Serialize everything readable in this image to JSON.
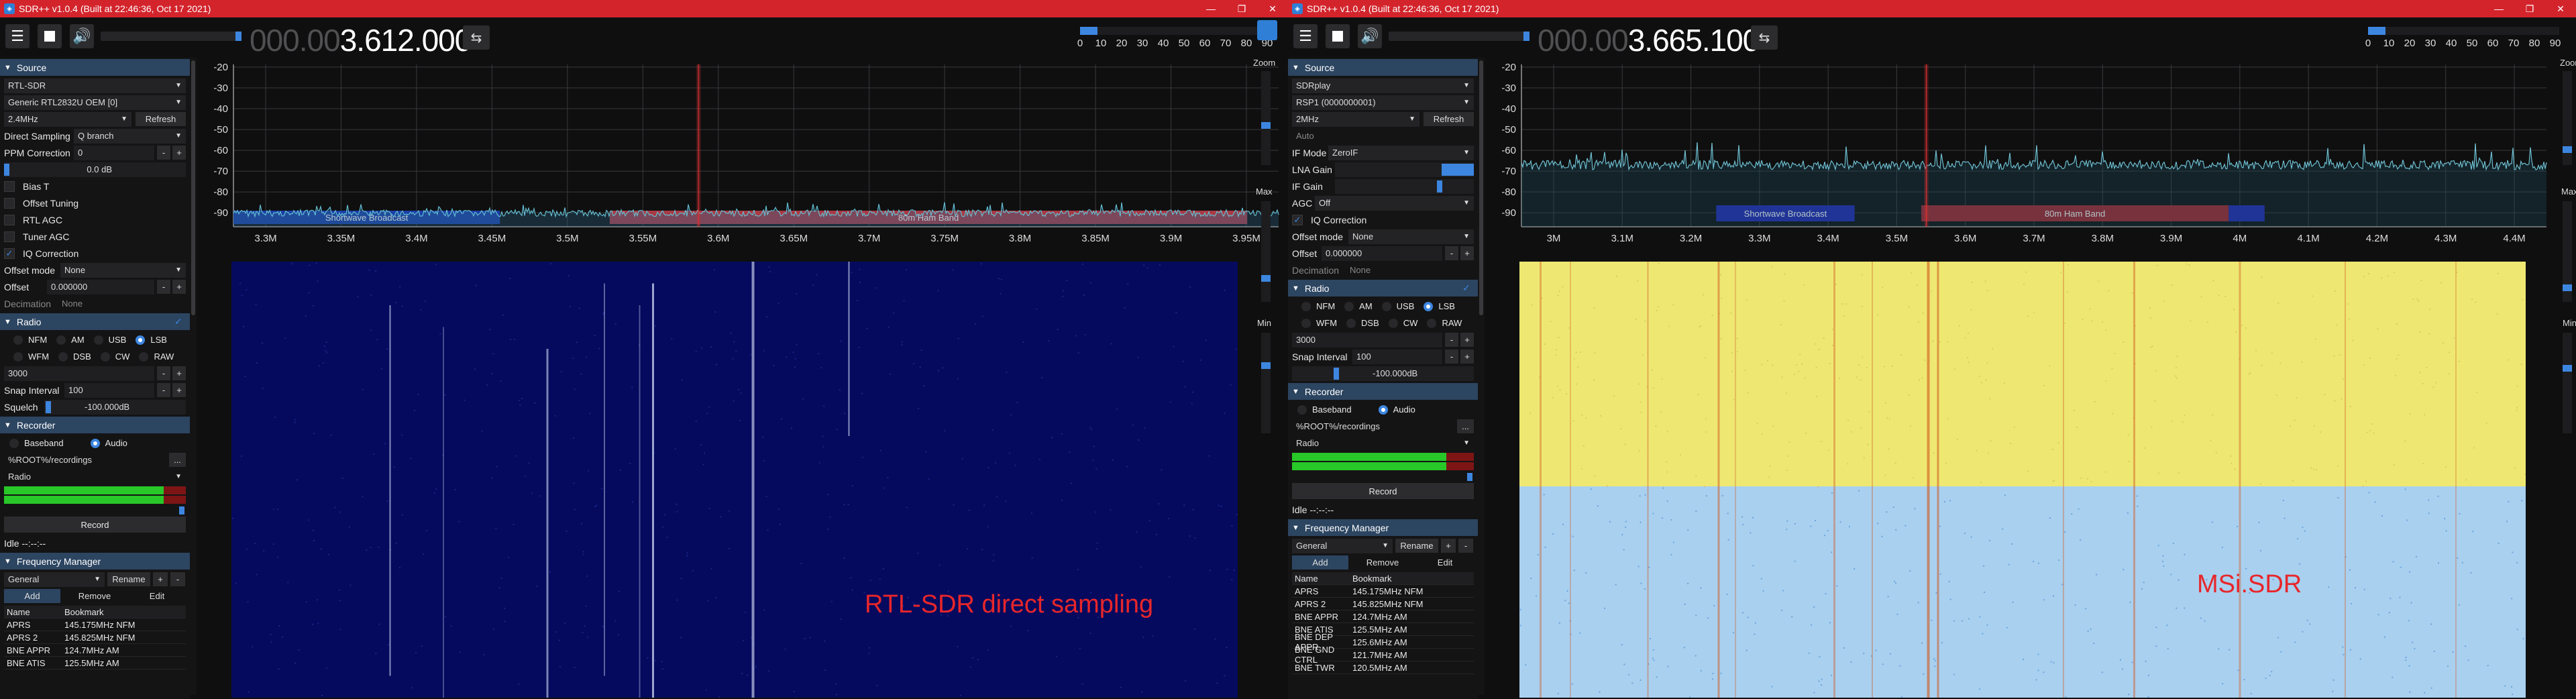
{
  "left": {
    "title": "SDR++ v1.0.4 (Built at 22:46:36, Oct 17 2021)",
    "freq_dim": "000.00",
    "freq_lit": "3.612.000",
    "snr_ticks": [
      "0",
      "10",
      "20",
      "30",
      "40",
      "50",
      "60",
      "70",
      "80",
      "90"
    ],
    "menu": {
      "source_header": "Source",
      "source_type": "RTL-SDR",
      "device": "Generic RTL2832U OEM [0]",
      "sample_rate": "2.4MHz",
      "refresh": "Refresh",
      "direct_sampling_label": "Direct Sampling",
      "direct_sampling_value": "Q branch",
      "ppm_label": "PPM Correction",
      "ppm_value": "0",
      "gain_value": "0.0 dB",
      "bias_t": "Bias T",
      "offset_tuning": "Offset Tuning",
      "rtl_agc": "RTL AGC",
      "tuner_agc": "Tuner AGC",
      "iq_correction": "IQ Correction",
      "offset_mode_label": "Offset mode",
      "offset_mode_value": "None",
      "offset_label": "Offset",
      "offset_value": "0.000000",
      "decimation_label": "Decimation",
      "decimation_value": "None",
      "radio_header": "Radio",
      "modes_row1": [
        "NFM",
        "AM",
        "USB",
        "LSB"
      ],
      "modes_row2": [
        "WFM",
        "DSB",
        "CW",
        "RAW"
      ],
      "bandwidth": "3000",
      "snap_label": "Snap Interval",
      "snap_value": "100",
      "squelch_label": "Squelch",
      "squelch_value": "-100.000dB",
      "recorder_header": "Recorder",
      "baseband": "Baseband",
      "audio": "Audio",
      "rec_path": "%ROOT%/recordings",
      "rec_browse": "...",
      "rec_stream": "Radio",
      "record_btn": "Record",
      "rec_status": "Idle --:--:--",
      "freqman_header": "Frequency Manager",
      "list_name": "General",
      "rename": "Rename",
      "plus": "+",
      "minus": "-",
      "add": "Add",
      "remove": "Remove",
      "edit": "Edit",
      "col_name": "Name",
      "col_bookmark": "Bookmark",
      "bookmarks": [
        {
          "name": "APRS",
          "value": "145.175MHz NFM"
        },
        {
          "name": "APRS 2",
          "value": "145.825MHz NFM"
        },
        {
          "name": "BNE APPR",
          "value": "124.7MHz AM"
        },
        {
          "name": "BNE ATIS",
          "value": "125.5MHz AM"
        }
      ]
    },
    "fft": {
      "y_ticks": [
        "-20",
        "-30",
        "-40",
        "-50",
        "-60",
        "-70",
        "-80",
        "-90"
      ],
      "x_ticks": [
        "3.3M",
        "3.35M",
        "3.4M",
        "3.45M",
        "3.5M",
        "3.55M",
        "3.6M",
        "3.65M",
        "3.7M",
        "3.75M",
        "3.8M",
        "3.85M",
        "3.9M",
        "3.95M"
      ],
      "bands": [
        "Shortwave Broadcast",
        "80m Ham Band"
      ]
    },
    "overlay": "RTL-SDR direct sampling"
  },
  "right": {
    "title": "SDR++ v1.0.4 (Built at 22:46:36, Oct 17 2021)",
    "freq_dim": "000.00",
    "freq_lit": "3.665.100",
    "snr_ticks": [
      "0",
      "10",
      "20",
      "30",
      "40",
      "50",
      "60",
      "70",
      "80",
      "90"
    ],
    "zoom_label": "Zoom",
    "max_label": "Max",
    "min_label": "Min",
    "menu": {
      "source_header": "Source",
      "source_type": "SDRplay",
      "device": "RSP1 (0000000001)",
      "sample_rate": "2MHz",
      "refresh": "Refresh",
      "agc_select": "Auto",
      "if_mode_label": "IF Mode",
      "if_mode_value": "ZeroIF",
      "lna_label": "LNA Gain",
      "if_gain_label": "IF Gain",
      "agc_label": "AGC",
      "agc_value": "Off",
      "iq_correction": "IQ Correction",
      "offset_mode_label": "Offset mode",
      "offset_mode_value": "None",
      "offset_label": "Offset",
      "offset_value": "0.000000",
      "decimation_label": "Decimation",
      "decimation_value": "None",
      "radio_header": "Radio",
      "modes_row1": [
        "NFM",
        "AM",
        "USB",
        "LSB"
      ],
      "modes_row2": [
        "WFM",
        "DSB",
        "CW",
        "RAW"
      ],
      "bandwidth": "3000",
      "snap_label": "Snap Interval",
      "snap_value": "100",
      "squelch_value": "-100.000dB",
      "recorder_header": "Recorder",
      "baseband": "Baseband",
      "audio": "Audio",
      "rec_path": "%ROOT%/recordings",
      "rec_browse": "...",
      "rec_stream": "Radio",
      "record_btn": "Record",
      "rec_status": "Idle --:--:--",
      "freqman_header": "Frequency Manager",
      "list_name": "General",
      "rename": "Rename",
      "plus": "+",
      "minus": "-",
      "add": "Add",
      "remove": "Remove",
      "edit": "Edit",
      "col_name": "Name",
      "col_bookmark": "Bookmark",
      "bookmarks": [
        {
          "name": "APRS",
          "value": "145.175MHz NFM"
        },
        {
          "name": "APRS 2",
          "value": "145.825MHz NFM"
        },
        {
          "name": "BNE APPR",
          "value": "124.7MHz AM"
        },
        {
          "name": "BNE ATIS",
          "value": "125.5MHz AM"
        },
        {
          "name": "BNE DEP APPR",
          "value": "125.6MHz AM"
        },
        {
          "name": "BNE GND CTRL",
          "value": "121.7MHz AM"
        },
        {
          "name": "BNE TWR",
          "value": "120.5MHz AM"
        }
      ]
    },
    "fft": {
      "y_ticks": [
        "-20",
        "-30",
        "-40",
        "-50",
        "-60",
        "-70",
        "-80",
        "-90"
      ],
      "x_ticks": [
        "3M",
        "3.1M",
        "3.2M",
        "3.3M",
        "3.4M",
        "3.5M",
        "3.6M",
        "3.7M",
        "3.8M",
        "3.9M",
        "4M",
        "4.1M",
        "4.2M",
        "4.3M",
        "4.4M"
      ],
      "bands": [
        "Shortwave Broadcast",
        "80m Ham Band"
      ]
    },
    "overlay": "MSi.SDR"
  },
  "colors": {
    "titlebar": "#d3242c",
    "accent": "#3d86e0",
    "header": "#2c4561"
  }
}
